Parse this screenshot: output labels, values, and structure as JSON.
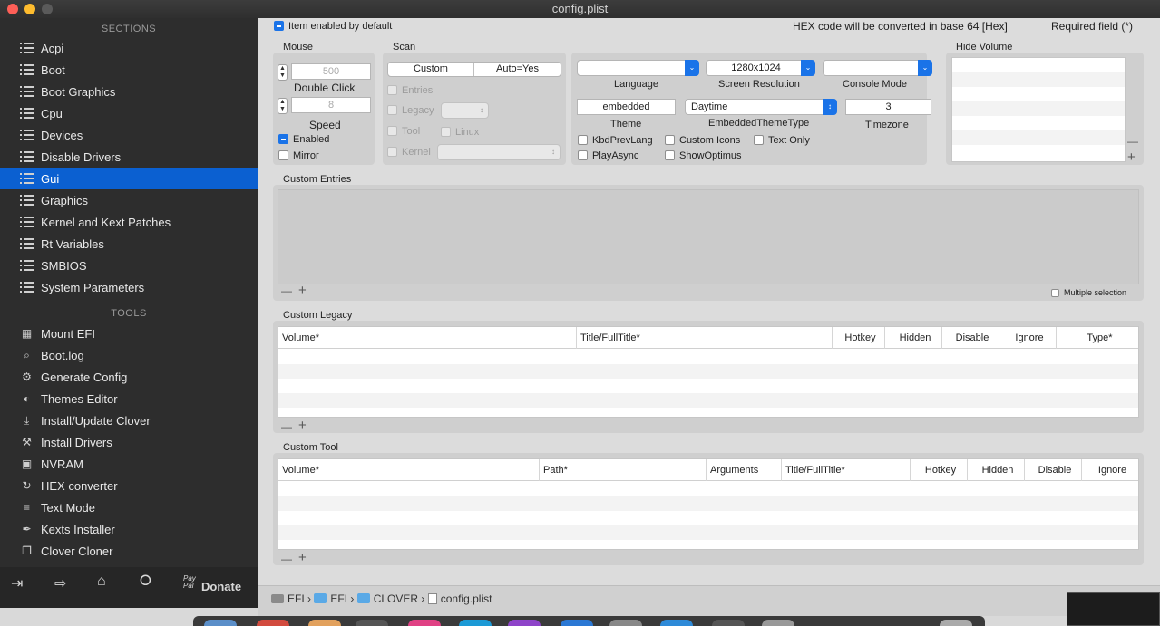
{
  "window": {
    "title": "config.plist"
  },
  "sidebar": {
    "sections_title": "SECTIONS",
    "sections": [
      "Acpi",
      "Boot",
      "Boot Graphics",
      "Cpu",
      "Devices",
      "Disable Drivers",
      "Gui",
      "Graphics",
      "Kernel and Kext Patches",
      "Rt Variables",
      "SMBIOS",
      "System Parameters"
    ],
    "active_index": 6,
    "tools_title": "TOOLS",
    "tools": [
      {
        "label": "Mount EFI",
        "icon": "disk-icon"
      },
      {
        "label": "Boot.log",
        "icon": "log-search-icon"
      },
      {
        "label": "Generate Config",
        "icon": "gears-icon"
      },
      {
        "label": "Themes Editor",
        "icon": "palette-icon"
      },
      {
        "label": "Install/Update Clover",
        "icon": "download-icon"
      },
      {
        "label": "Install Drivers",
        "icon": "tools-icon"
      },
      {
        "label": "NVRAM",
        "icon": "chip-icon"
      },
      {
        "label": "HEX converter",
        "icon": "refresh-icon"
      },
      {
        "label": "Text Mode",
        "icon": "text-icon"
      },
      {
        "label": "Kexts Installer",
        "icon": "wrench-icon"
      },
      {
        "label": "Clover Cloner",
        "icon": "copy-icon"
      }
    ],
    "donate_label": "Donate",
    "paypal_label": "Pay Pal"
  },
  "header": {
    "item_enabled_label": "Item enabled by default",
    "hex_note": "HEX code will be converted in base 64 [Hex]",
    "required_note": "Required field (*)"
  },
  "mouse": {
    "title": "Mouse",
    "double_click_value": "500",
    "double_click_label": "Double Click",
    "speed_value": "8",
    "speed_label": "Speed",
    "enabled_label": "Enabled",
    "mirror_label": "Mirror"
  },
  "scan": {
    "title": "Scan",
    "segments": [
      "Custom",
      "Auto=Yes"
    ],
    "entries_label": "Entries",
    "legacy_label": "Legacy",
    "tool_label": "Tool",
    "linux_label": "Linux",
    "kernel_label": "Kernel"
  },
  "settings": {
    "language_label": "Language",
    "language_value": "",
    "screen_resolution_label": "Screen Resolution",
    "screen_resolution_value": "1280x1024",
    "console_mode_label": "Console Mode",
    "console_mode_value": "",
    "theme_value": "embedded",
    "theme_label": "Theme",
    "embedded_theme_type_value": "Daytime",
    "embedded_theme_type_label": "EmbeddedThemeType",
    "timezone_value": "3",
    "timezone_label": "Timezone",
    "kbdprevlang_label": "KbdPrevLang",
    "custom_icons_label": "Custom Icons",
    "text_only_label": "Text Only",
    "playasync_label": "PlayAsync",
    "showoptimus_label": "ShowOptimus"
  },
  "hide_volume": {
    "title": "Hide Volume"
  },
  "custom_entries": {
    "title": "Custom Entries",
    "multiple_selection_label": "Multiple selection"
  },
  "custom_legacy": {
    "title": "Custom Legacy",
    "columns": [
      "Volume*",
      "Title/FullTitle*",
      "Hotkey",
      "Hidden",
      "Disable",
      "Ignore",
      "Type*"
    ]
  },
  "custom_tool": {
    "title": "Custom Tool",
    "columns": [
      "Volume*",
      "Path*",
      "Arguments",
      "Title/FullTitle*",
      "Hotkey",
      "Hidden",
      "Disable",
      "Ignore"
    ]
  },
  "breadcrumb": [
    "EFI",
    "EFI",
    "CLOVER",
    "config.plist"
  ]
}
